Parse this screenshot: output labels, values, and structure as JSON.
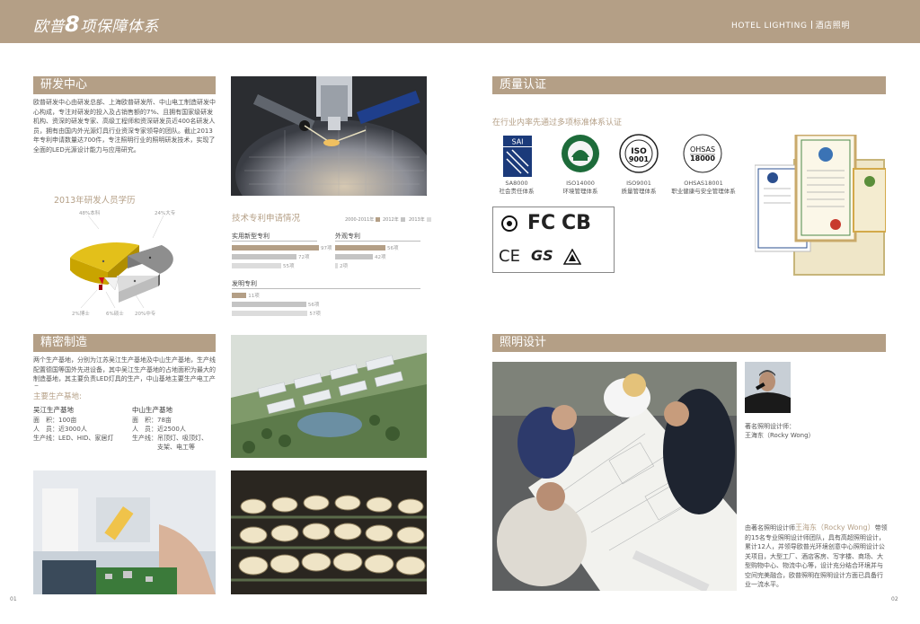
{
  "header": {
    "title_prefix": "欧普",
    "title_num": "8",
    "title_suffix": "项保障体系",
    "right_en": "HOTEL LIGHTING",
    "right_cn": "酒店照明"
  },
  "rd": {
    "heading": "研发中心",
    "text": "欧普研发中心由研发总部、上海欧普研发所、中山电工制造研发中心构成，专注对研发的投入及占销售额的7%、且拥有国家级研发机构、资深的研发专家、高级工程师和资深研发员近400名研发人员，拥有由国内外光源灯具行业资深专家领导的团队。截止2013年专利申请数量达700件，专注照明行业的照明研发技术，实现了全面的LED光源设计能力与应用研究。"
  },
  "pie": {
    "title": "2013年研发人员学历",
    "labels": [
      "48%本科",
      "24%大专",
      "2%博士",
      "6%硕士",
      "20%中专"
    ]
  },
  "chart_data": {
    "type": "bar",
    "title": "技术专利申请情况",
    "legend": [
      "2000-2011年",
      "2012年",
      "2013年"
    ],
    "series_colors": [
      "#b49f86",
      "#c4c4c4",
      "#dcdcdc"
    ],
    "groups": [
      {
        "name": "实用新型专利",
        "values": [
          97,
          72,
          55
        ],
        "labels": [
          "97项",
          "72项",
          "55项"
        ]
      },
      {
        "name": "外观专利",
        "values": [
          56,
          42,
          2
        ],
        "labels": [
          "56项",
          "42项",
          "2项"
        ]
      },
      {
        "name": "发明专利",
        "values": [
          11,
          56,
          57
        ],
        "labels": [
          "11项",
          "56项",
          "57项"
        ]
      }
    ],
    "xlim": [
      0,
      100
    ]
  },
  "quality": {
    "heading": "质量认证",
    "subtitle": "在行业内率先通过多项标准体系认证",
    "logos": [
      {
        "name": "SA8000",
        "caption1": "SA8000",
        "caption2": "社会责任体系"
      },
      {
        "name": "ISO14000",
        "caption1": "ISO14000",
        "caption2": "环境管理体系"
      },
      {
        "name": "ISO9001",
        "caption1": "ISO9001",
        "caption2": "质量管理体系"
      },
      {
        "name": "OHSAS18001",
        "caption1": "OHSAS18001",
        "caption2": "职业健康与安全管理体系"
      }
    ],
    "logo_texts": {
      "sai": "SAI",
      "iso": "ISO",
      "iso_num": "9001",
      "ohsas": "OHSAS",
      "ohsas_num": "18000"
    },
    "cert_marks": {
      "fc": "FC",
      "cb": "CB",
      "ce": "CE",
      "gs": "GS"
    }
  },
  "manufacturing": {
    "heading": "精密制造",
    "text": "两个生产基地，分别为江苏吴江生产基地及中山生产基地，生产线配置德国等国外先进设备，其中吴江生产基地的占地面积为最大的制造基地，其主要负责LED灯具的生产，中山基地主要生产电工产品。",
    "bases_title": "主要生产基地:",
    "base1": {
      "name": "吴江生产基地",
      "area": "面　积：100亩",
      "staff": "人　员：近3000人",
      "products": "生产线：LED、HID、家居灯"
    },
    "base2": {
      "name": "中山生产基地",
      "area": "面　积：78亩",
      "staff": "人　员：近2500人",
      "products1": "生产线：吊顶灯、吸顶灯、",
      "products2": "支架、电工等"
    }
  },
  "lighting": {
    "heading": "照明设计",
    "designer_caption1": "著名照明设计师：",
    "designer_caption2": "王海东（Rocky Wong）",
    "text_prefix": "由著名照明设计师",
    "text_name": "王海东（Rocky Wong）",
    "text_suffix": "带领的15名专业照明设计师团队，具有高超照明设计，累计12人，并领导欧普光环境创意中心照明设计公关项目，大型工厂、酒店客房、写字楼、商场、大型购物中心、物流中心等，设计充分结合环境并与空间完美融合，欧普照明在照明设计方面已具备行业一流水平。"
  },
  "pages": {
    "left": "01",
    "right": "02"
  }
}
